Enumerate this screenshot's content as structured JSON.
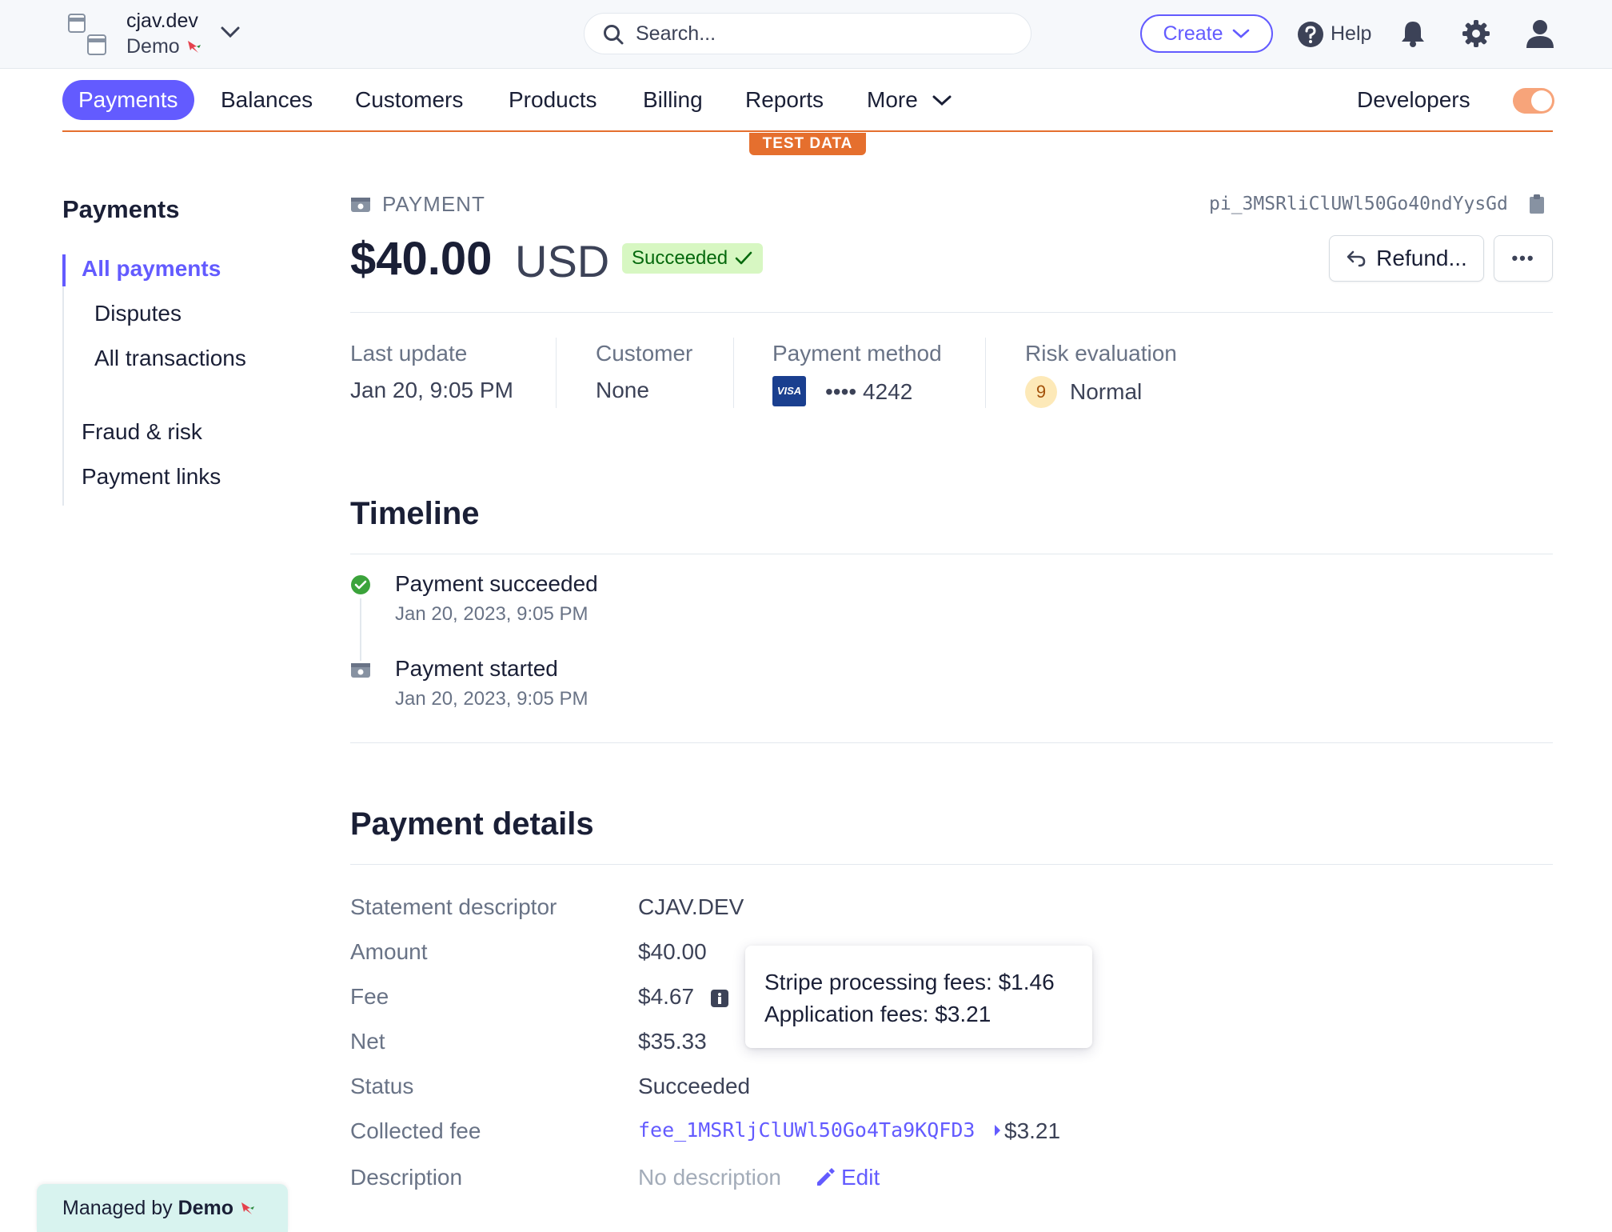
{
  "account": {
    "name": "cjav.dev",
    "mode": "Demo"
  },
  "search": {
    "placeholder": "Search..."
  },
  "topbar": {
    "create_label": "Create",
    "help_label": "Help"
  },
  "nav": {
    "items": [
      "Payments",
      "Balances",
      "Customers",
      "Products",
      "Billing",
      "Reports",
      "More"
    ],
    "active": "Payments",
    "developers_label": "Developers",
    "test_data_label": "TEST DATA"
  },
  "sidebar": {
    "title": "Payments",
    "items": [
      "All payments",
      "Disputes",
      "All transactions",
      "Fraud & risk",
      "Payment links"
    ],
    "active": "All payments"
  },
  "payment": {
    "label": "PAYMENT",
    "id": "pi_3MSRliClUWl50Go40ndYysGd",
    "amount": "$40.00",
    "currency": "USD",
    "status": "Succeeded",
    "refund_label": "Refund...",
    "more_label": "•••"
  },
  "summary": {
    "last_update_label": "Last update",
    "last_update_value": "Jan 20, 9:05 PM",
    "customer_label": "Customer",
    "customer_value": "None",
    "method_label": "Payment method",
    "card_brand": "VISA",
    "card_last4": "•••• 4242",
    "risk_label": "Risk evaluation",
    "risk_score": "9",
    "risk_value": "Normal"
  },
  "timeline": {
    "title": "Timeline",
    "events": [
      {
        "title": "Payment succeeded",
        "date": "Jan 20, 2023, 9:05 PM"
      },
      {
        "title": "Payment started",
        "date": "Jan 20, 2023, 9:05 PM"
      }
    ]
  },
  "details": {
    "title": "Payment details",
    "rows": [
      {
        "label": "Statement descriptor",
        "value": "CJAV.DEV"
      },
      {
        "label": "Amount",
        "value": "$40.00"
      },
      {
        "label": "Fee",
        "value": "$4.67"
      },
      {
        "label": "Net",
        "value": "$35.33"
      },
      {
        "label": "Status",
        "value": "Succeeded"
      },
      {
        "label": "Collected fee",
        "value": "fee_1MSRljClUWl50Go4Ta9KQFD3",
        "amount": "$3.21"
      },
      {
        "label": "Description",
        "value": "No description",
        "edit_label": "Edit"
      }
    ],
    "tooltip": {
      "line1": "Stripe processing fees: $1.46",
      "line2": "Application fees: $3.21"
    }
  },
  "footer": {
    "managed_prefix": "Managed by",
    "managed_name": "Demo"
  },
  "colors": {
    "accent": "#635bff",
    "test_orange": "#e56f2e",
    "success_bg": "#d7f7c2",
    "success_fg": "#05690d"
  }
}
